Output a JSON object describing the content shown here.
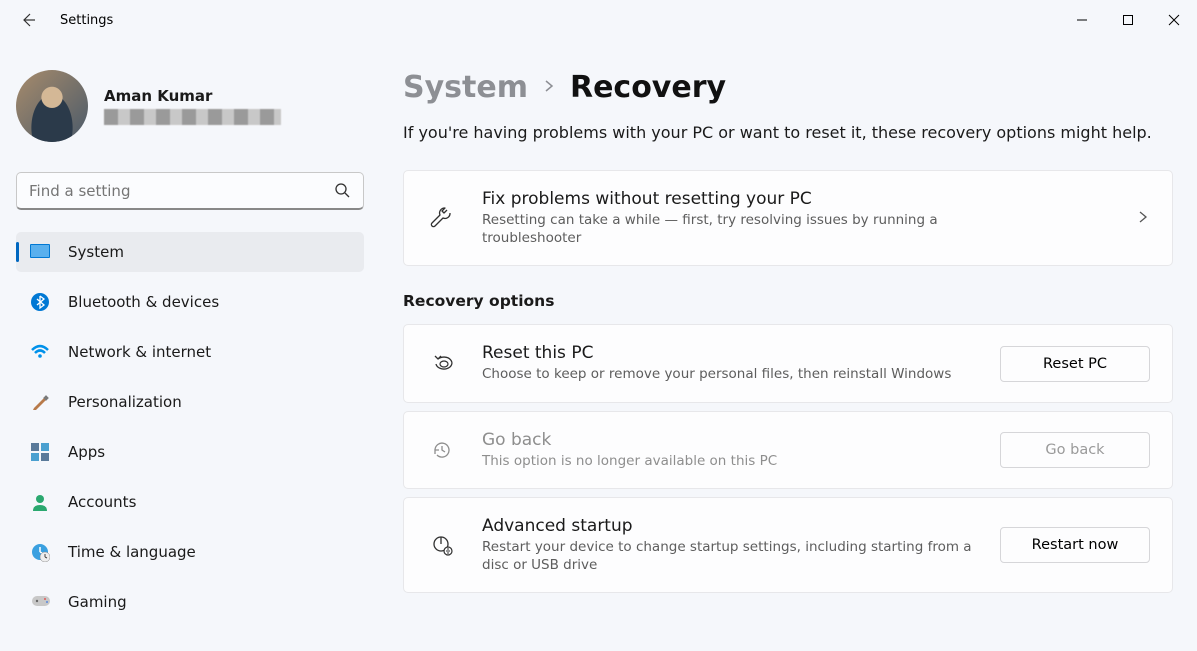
{
  "app_title": "Settings",
  "user": {
    "name": "Aman Kumar"
  },
  "search": {
    "placeholder": "Find a setting"
  },
  "nav": {
    "items": [
      {
        "label": "System"
      },
      {
        "label": "Bluetooth & devices"
      },
      {
        "label": "Network & internet"
      },
      {
        "label": "Personalization"
      },
      {
        "label": "Apps"
      },
      {
        "label": "Accounts"
      },
      {
        "label": "Time & language"
      },
      {
        "label": "Gaming"
      }
    ]
  },
  "breadcrumb": {
    "parent": "System",
    "current": "Recovery"
  },
  "intro": "If you're having problems with your PC or want to reset it, these recovery options might help.",
  "fix_card": {
    "title": "Fix problems without resetting your PC",
    "sub": "Resetting can take a while — first, try resolving issues by running a troubleshooter"
  },
  "section_title": "Recovery options",
  "reset_card": {
    "title": "Reset this PC",
    "sub": "Choose to keep or remove your personal files, then reinstall Windows",
    "button": "Reset PC"
  },
  "goback_card": {
    "title": "Go back",
    "sub": "This option is no longer available on this PC",
    "button": "Go back"
  },
  "advanced_card": {
    "title": "Advanced startup",
    "sub": "Restart your device to change startup settings, including starting from a disc or USB drive",
    "button": "Restart now"
  }
}
